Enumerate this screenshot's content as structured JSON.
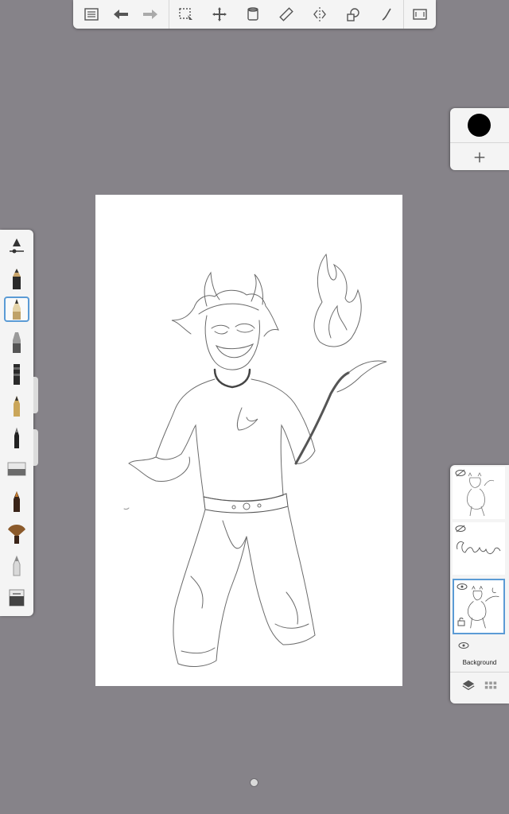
{
  "toolbar": {
    "left": [
      "gallery-icon",
      "undo-icon",
      "redo-icon"
    ],
    "tools": [
      "selection-icon",
      "transform-icon",
      "fill-bucket-icon",
      "ruler-icon",
      "symmetry-icon",
      "shapes-icon",
      "curve-icon"
    ],
    "right": [
      "fullscreen-icon"
    ]
  },
  "brushes": [
    "brush-settings",
    "pencil",
    "ballpoint-pen",
    "marker",
    "airbrush",
    "ink-pen",
    "paint-brush",
    "eraser",
    "paint-brush-2",
    "fan-brush",
    "smudge",
    "brush-library"
  ],
  "selected_brush": "ballpoint-pen",
  "colors": {
    "current_color": "#000000",
    "selection_accent": "#5b9bd5",
    "background": "#868389"
  },
  "layers": {
    "items": [
      {
        "name": "",
        "visible": false,
        "selected": false
      },
      {
        "name": "",
        "visible": false,
        "selected": false
      },
      {
        "name": "",
        "visible": true,
        "selected": true
      }
    ],
    "background_label": "Background"
  }
}
